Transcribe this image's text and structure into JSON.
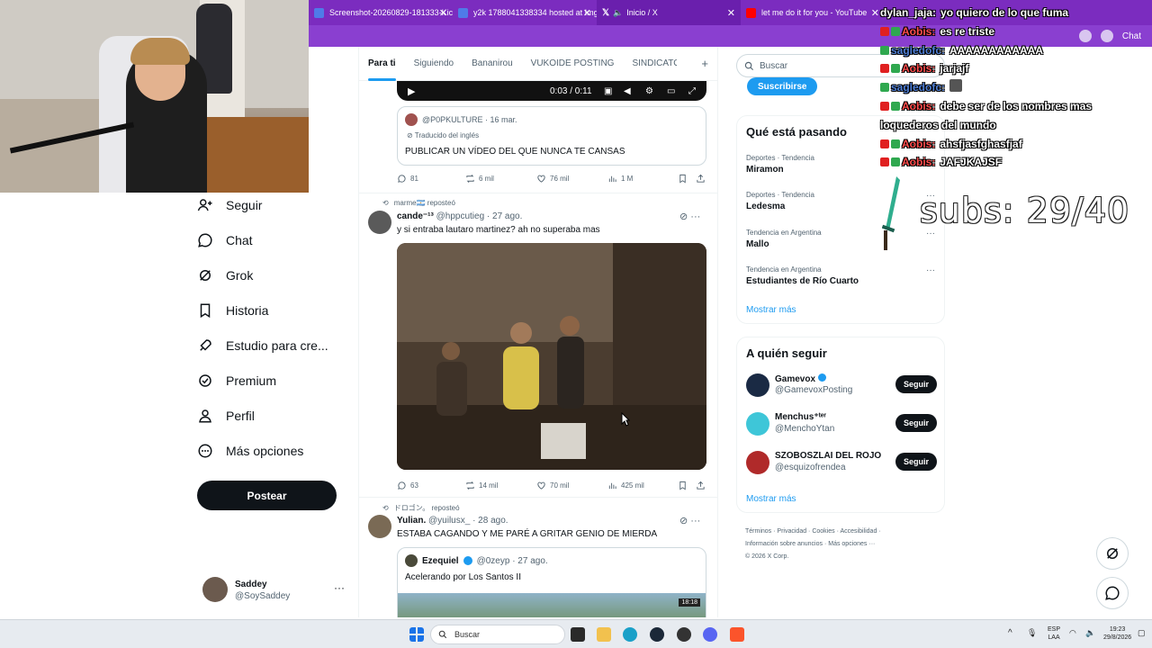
{
  "browser": {
    "tabs": [
      {
        "label": "Screenshot-20260829-181333-Kic",
        "color": "#4f7be8"
      },
      {
        "label": "y2k 1788041338334 hosted at Img",
        "color": "#4f7be8"
      },
      {
        "label": "Inicio / X",
        "color": "#000000"
      },
      {
        "label": "let me do it for you - YouTube",
        "color": "#ff0000"
      }
    ],
    "profile_label": "Chat"
  },
  "sidebar": {
    "items": [
      {
        "label": "Seguir",
        "icon": "add-user-icon"
      },
      {
        "label": "Chat",
        "icon": "chat-bubble-icon"
      },
      {
        "label": "Grok",
        "icon": "grok-icon"
      },
      {
        "label": "Historia",
        "icon": "bookmark-icon"
      },
      {
        "label": "Estudio para cre...",
        "icon": "rocket-icon"
      },
      {
        "label": "Premium",
        "icon": "verified-badge-icon"
      },
      {
        "label": "Perfil",
        "icon": "person-icon"
      },
      {
        "label": "Más opciones",
        "icon": "more-circle-icon"
      }
    ],
    "post_button": "Postear",
    "profile": {
      "name": "Saddey",
      "handle": "@SoySaddey",
      "more": "···"
    }
  },
  "feed": {
    "tabs": [
      "Para ti",
      "Siguiendo",
      "Bananirou",
      "VUKOIDE POSTING",
      "SINDICATO"
    ],
    "add_tab": "+",
    "post1": {
      "video_time": "0:03 / 0:11",
      "quote_author": "@P0PKULTURE · 16 mar.",
      "quote_translated": "Traducido del inglés",
      "quote_text": "PUBLICAR UN VÍDEO DEL QUE NUNCA TE CANSAS",
      "replies": "81",
      "reposts": "6 mil",
      "likes": "76 mil",
      "views": "1 M"
    },
    "post2": {
      "reposted_by": "marme🇦🇷 reposteó",
      "name": "cande⁻¹³",
      "handle_date": "@hppcutieg · 27 ago.",
      "text": "y si entraba lautaro martinez? ah no superaba mas",
      "replies": "63",
      "reposts": "14 mil",
      "likes": "70 mil",
      "views": "425 mil"
    },
    "post3": {
      "reposted_by": "ドロゴン。 reposteó",
      "name": "Yulian.",
      "handle_date": "@yuilusx_ · 28 ago.",
      "text": "ESTABA CAGANDO Y ME PARÉ A GRITAR GENIO DE MIERDA",
      "quote_name": "Ezequiel",
      "quote_handle": "@0zeyp · 27 ago.",
      "quote_text": "Acelerando por Los Santos II",
      "video_time": "18:18"
    }
  },
  "right": {
    "search_placeholder": "Buscar",
    "subscribe": "Suscribirse",
    "trends_title": "Qué está pasando",
    "trends": [
      {
        "category": "Deportes · Tendencia",
        "name": "Miramon"
      },
      {
        "category": "Deportes · Tendencia",
        "name": "Ledesma"
      },
      {
        "category": "Tendencia en Argentina",
        "name": "Mallo"
      },
      {
        "category": "Tendencia en Argentina",
        "name": "Estudiantes de Río Cuarto"
      }
    ],
    "show_more": "Mostrar más",
    "who_title": "A quién seguir",
    "follows": [
      {
        "name": "Gamevox",
        "handle": "@GamevoxPosting",
        "button": "Seguir"
      },
      {
        "name": "Menchus⁺ᵗᵉʳ",
        "handle": "@MenchoYtan",
        "button": "Seguir"
      },
      {
        "name": "SZOBOSZLAI DEL ROJO",
        "handle": "@esquizofrendea",
        "button": "Seguir"
      }
    ],
    "show_more_2": "Mostrar más",
    "footer": [
      "Términos",
      "Privacidad",
      "Cookies",
      "Accesibilidad",
      "Información sobre anuncios",
      "Más opciones ···",
      "© 2026 X Corp."
    ]
  },
  "stream_chat": [
    {
      "user": "dylan_jaja:",
      "msg": "yo quiero de lo que fuma",
      "color": "#ffffff"
    },
    {
      "user": "Aobis:",
      "msg": "es re triste",
      "color": "#ff4d4d"
    },
    {
      "user": "sagledofc:",
      "msg": "AAAAAAAAAAAA",
      "color": "#4f7fd6"
    },
    {
      "user": "Aobis:",
      "msg": "jarjajf",
      "color": "#ff4d4d"
    },
    {
      "user": "sagledofc:",
      "msg": "",
      "color": "#4f7fd6"
    },
    {
      "user": "Aobis:",
      "msg": "debe ser de los nombres mas loquederos del mundo",
      "color": "#ff4d4d"
    },
    {
      "user": "Aobis:",
      "msg": "ahsfjasfghasfjaf",
      "color": "#ff4d4d"
    },
    {
      "user": "Aobis:",
      "msg": "JAFJKAJSF",
      "color": "#ff4d4d"
    }
  ],
  "overlay": {
    "subs": "subs: 29/40"
  },
  "taskbar": {
    "search": "Buscar",
    "lang1": "ESP",
    "lang2": "LAA",
    "time": "19:23",
    "date": "29/8/2026"
  }
}
